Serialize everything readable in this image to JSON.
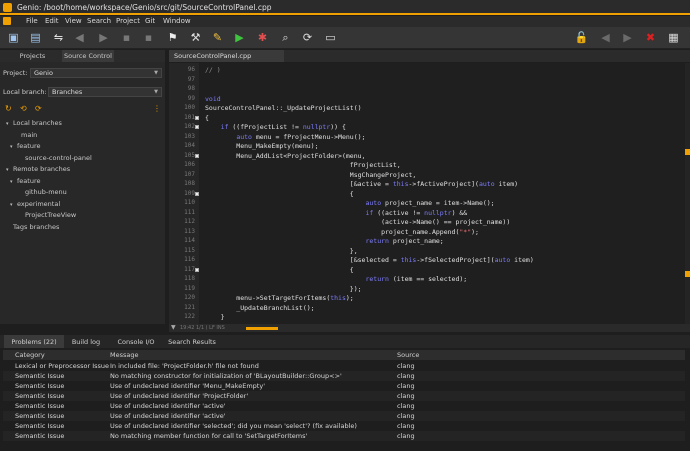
{
  "window": {
    "title": "Genio: /boot/home/workspace/Genio/src/git/SourceControlPanel.cpp"
  },
  "menu": [
    "File",
    "Edit",
    "View",
    "Search",
    "Project",
    "Git",
    "Window"
  ],
  "left_tabs": [
    "Projects",
    "Source Control"
  ],
  "project": {
    "label": "Project:",
    "value": "Genio"
  },
  "branch": {
    "label": "Local branch:",
    "value": "Branches"
  },
  "tree": [
    {
      "label": "Local branches",
      "indent": 0,
      "arrow": "▾"
    },
    {
      "label": "main",
      "indent": 2,
      "arrow": ""
    },
    {
      "label": "feature",
      "indent": 1,
      "arrow": "▾"
    },
    {
      "label": "source-control-panel",
      "indent": 3,
      "arrow": ""
    },
    {
      "label": "Remote branches",
      "indent": 0,
      "arrow": "▾"
    },
    {
      "label": "feature",
      "indent": 1,
      "arrow": "▾"
    },
    {
      "label": "github-menu",
      "indent": 3,
      "arrow": ""
    },
    {
      "label": "experimental",
      "indent": 1,
      "arrow": "▾"
    },
    {
      "label": "ProjectTreeView",
      "indent": 3,
      "arrow": ""
    },
    {
      "label": "Tags branches",
      "indent": 0,
      "arrow": ""
    }
  ],
  "editor_tab": "SourceControlPanel.cpp",
  "code_lines": [
    {
      "n": "96",
      "t": "// )"
    },
    {
      "n": "97",
      "t": ""
    },
    {
      "n": "98",
      "t": ""
    },
    {
      "n": "99",
      "t": "void"
    },
    {
      "n": "100",
      "t": "SourceControlPanel::_UpdateProjectList()"
    },
    {
      "n": "101",
      "t": "{"
    },
    {
      "n": "102",
      "t": "    if ((fProjectList != nullptr)) {"
    },
    {
      "n": "103",
      "t": "        auto menu = fProjectMenu->Menu();"
    },
    {
      "n": "104",
      "t": "        Menu_MakeEmpty(menu);"
    },
    {
      "n": "105",
      "t": "        Menu_AddList<ProjectFolder>(menu,"
    },
    {
      "n": "106",
      "t": "                                     fProjectList,"
    },
    {
      "n": "107",
      "t": "                                     MsgChangeProject,"
    },
    {
      "n": "108",
      "t": "                                     [&active = this->fActiveProject](auto item)"
    },
    {
      "n": "109",
      "t": "                                     {"
    },
    {
      "n": "110",
      "t": "                                         auto project_name = item->Name();"
    },
    {
      "n": "111",
      "t": "                                         if ((active != nullptr) &&"
    },
    {
      "n": "112",
      "t": "                                             (active->Name() == project_name))"
    },
    {
      "n": "113",
      "t": "                                             project_name.Append(\"*\");"
    },
    {
      "n": "114",
      "t": "                                         return project_name;"
    },
    {
      "n": "115",
      "t": "                                     },"
    },
    {
      "n": "116",
      "t": "                                     [&selected = this->fSelectedProject](auto item)"
    },
    {
      "n": "117",
      "t": "                                     {"
    },
    {
      "n": "118",
      "t": "                                         return (item == selected);"
    },
    {
      "n": "119",
      "t": "                                     });"
    },
    {
      "n": "120",
      "t": "        menu->SetTargetForItems(this);"
    },
    {
      "n": "121",
      "t": "        _UpdateBranchList();"
    },
    {
      "n": "122",
      "t": "    }"
    }
  ],
  "status_line": "19:42  1/1  ( LF  INS",
  "bottom_tabs": [
    "Problems (22)",
    "Build log",
    "Console I/O",
    "Search Results"
  ],
  "issues": {
    "headers": [
      "Category",
      "Message",
      "Source"
    ],
    "rows": [
      [
        "Lexical or Preprocessor Issue",
        "In included file: 'ProjectFolder.h' file not found",
        "clang"
      ],
      [
        "Semantic Issue",
        "No matching constructor for initialization of 'BLayoutBuilder::Group<>'",
        "clang"
      ],
      [
        "Semantic Issue",
        "Use of undeclared identifier 'Menu_MakeEmpty'",
        "clang"
      ],
      [
        "Semantic Issue",
        "Use of undeclared identifier 'ProjectFolder'",
        "clang"
      ],
      [
        "Semantic Issue",
        "Use of undeclared identifier 'active'",
        "clang"
      ],
      [
        "Semantic Issue",
        "Use of undeclared identifier 'active'",
        "clang"
      ],
      [
        "Semantic Issue",
        "Use of undeclared identifier 'selected'; did you mean 'select'? (fix available)",
        "clang"
      ],
      [
        "Semantic Issue",
        "No matching member function for call to 'SetTargetForItems'",
        "clang"
      ]
    ]
  },
  "colors": {
    "accent": "#f0a000",
    "keyword": "#7e7eff",
    "punct": "#ff6a6a"
  }
}
